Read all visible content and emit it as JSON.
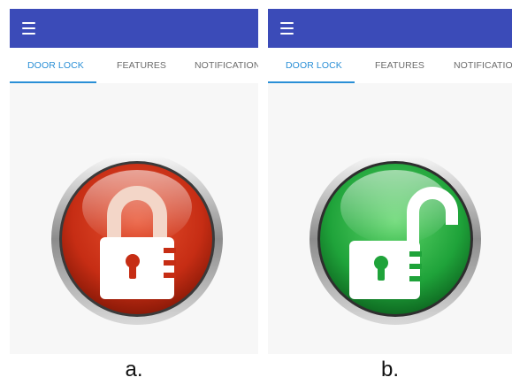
{
  "panels": [
    {
      "id": "a",
      "tabs": [
        {
          "label": "DOOR LOCK"
        },
        {
          "label": "FEATURES"
        },
        {
          "label": "NOTIFICATIONS"
        }
      ],
      "active_tab": 0,
      "lock_state": "locked",
      "lock_color": "#c62d14",
      "caption": "a."
    },
    {
      "id": "b",
      "tabs": [
        {
          "label": "DOOR LOCK"
        },
        {
          "label": "FEATURES"
        },
        {
          "label": "NOTIFICATION"
        }
      ],
      "active_tab": 0,
      "lock_state": "unlocked",
      "lock_color": "#1fa33a",
      "caption": "b."
    }
  ],
  "colors": {
    "app_bar": "#3b4bb8",
    "tab_active": "#2a8fd6",
    "tab_inactive": "#6b6b6b"
  },
  "icons": {
    "menu": "hamburger-menu-icon",
    "locked": "padlock-locked-icon",
    "unlocked": "padlock-unlocked-icon"
  }
}
